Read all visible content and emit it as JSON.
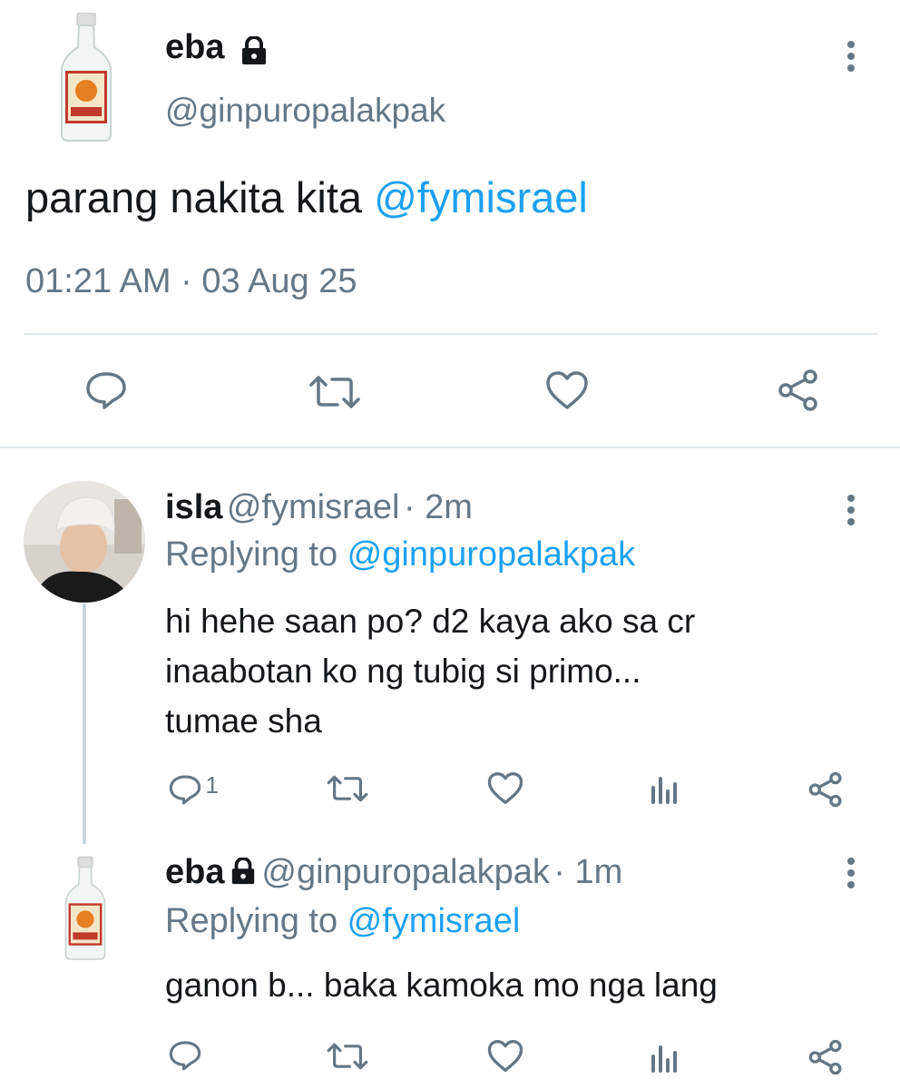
{
  "main_tweet": {
    "display_name": "eba",
    "handle": "@ginpuropalakpak",
    "text_prefix": "parang nakita kita ",
    "mention": "@fymisrael",
    "timestamp": "01:21 AM · 03 Aug 25",
    "actions": [
      "reply-icon",
      "retweet-icon",
      "like-icon",
      "share-icon"
    ]
  },
  "replies": [
    {
      "display_name": "isla",
      "handle": "@fymisrael",
      "time": "· 2m",
      "replying_label": "Replying to ",
      "replying_to": "@ginpuropalakpak",
      "text_lines": [
        "hi hehe saan po? d2 kaya ako sa cr",
        "inaabotan ko ng tubig si primo...",
        "tumae sha"
      ],
      "reply_count": "1"
    },
    {
      "display_name": "eba",
      "handle": "@ginpuropalakpak",
      "time": "· 1m",
      "replying_label": "Replying to ",
      "replying_to": "@fymisrael",
      "text_lines": [
        "ganon b... baka kamoka mo nga lang"
      ],
      "reply_count": ""
    }
  ],
  "colors": {
    "link": "#1da1f2",
    "muted": "#657786",
    "divider": "#e1e8ed"
  }
}
